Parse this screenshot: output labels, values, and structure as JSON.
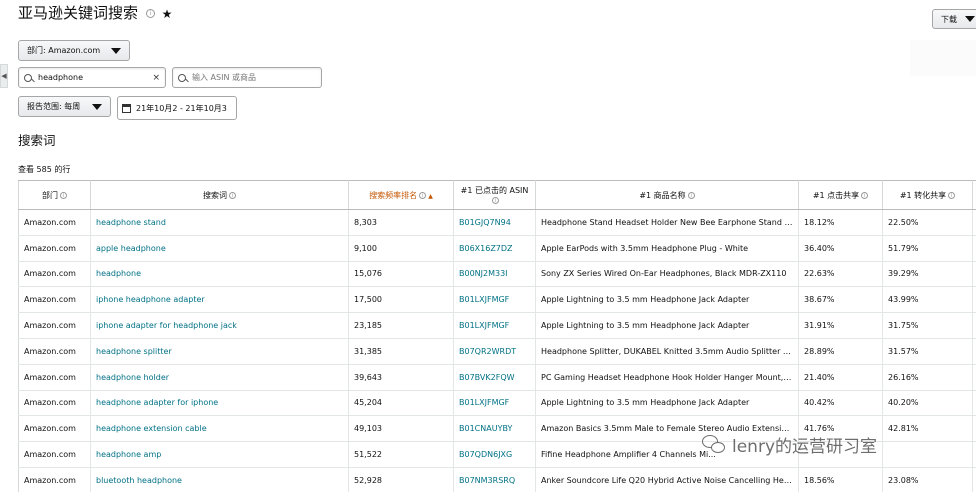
{
  "page": {
    "title": "亚马逊关键词搜索",
    "info_glyph": "i",
    "star_glyph": "★"
  },
  "toolbar": {
    "download_label": "下载",
    "department_label": "部门: Amazon.com",
    "search_value": "headphone",
    "search_clear": "×",
    "asin_placeholder": "输入 ASIN 或商品",
    "range_label": "报告范围: 每周",
    "date_value": "21年10月2 - 21年10月3"
  },
  "left_tab": {
    "glyph": "◀"
  },
  "section": {
    "title": "搜索词",
    "row_count": "查看 585 的行"
  },
  "table": {
    "headers": {
      "department": "部门",
      "search_term": "搜索词",
      "frequency_rank": "搜索频率排名",
      "clicked_asin": "#1 已点击的 ASIN",
      "product_name": "#1 商品名称",
      "click_share": "#1 点击共享",
      "conversion_share": "#1 转化共享"
    },
    "rows": [
      {
        "department": "Amazon.com",
        "term": "headphone stand",
        "rank": "8,303",
        "asin": "B01GJQ7N94",
        "product": "Headphone Stand Headset Holder New Bee Earphone Stand with...",
        "click": "18.12%",
        "conv": "22.50%"
      },
      {
        "department": "Amazon.com",
        "term": "apple headphone",
        "rank": "9,100",
        "asin": "B06X16Z7DZ",
        "product": "Apple EarPods with 3.5mm Headphone Plug - White",
        "click": "36.40%",
        "conv": "51.79%"
      },
      {
        "department": "Amazon.com",
        "term": "headphone",
        "rank": "15,076",
        "asin": "B00NJ2M33I",
        "product": "Sony ZX Series Wired On-Ear Headphones, Black MDR-ZX110",
        "click": "22.63%",
        "conv": "39.29%"
      },
      {
        "department": "Amazon.com",
        "term": "iphone headphone adapter",
        "rank": "17,500",
        "asin": "B01LXJFMGF",
        "product": "Apple Lightning to 3.5 mm Headphone Jack Adapter",
        "click": "38.67%",
        "conv": "43.99%"
      },
      {
        "department": "Amazon.com",
        "term": "iphone adapter for headphone jack",
        "rank": "23,185",
        "asin": "B01LXJFMGF",
        "product": "Apple Lightning to 3.5 mm Headphone Jack Adapter",
        "click": "31.91%",
        "conv": "31.75%"
      },
      {
        "department": "Amazon.com",
        "term": "headphone splitter",
        "rank": "31,385",
        "asin": "B07QR2WRDT",
        "product": "Headphone Splitter, DUKABEL Knitted 3.5mm Audio Splitter T...",
        "click": "28.89%",
        "conv": "31.57%"
      },
      {
        "department": "Amazon.com",
        "term": "headphone holder",
        "rank": "39,643",
        "asin": "B07BVK2FQW",
        "product": "PC Gaming Headset Headphone Hook Holder Hanger Mount, H...",
        "click": "21.40%",
        "conv": "26.16%"
      },
      {
        "department": "Amazon.com",
        "term": "headphone adapter for iphone",
        "rank": "45,204",
        "asin": "B01LXJFMGF",
        "product": "Apple Lightning to 3.5 mm Headphone Jack Adapter",
        "click": "40.42%",
        "conv": "40.20%"
      },
      {
        "department": "Amazon.com",
        "term": "headphone extension cable",
        "rank": "49,103",
        "asin": "B01CNAUYBY",
        "product": "Amazon Basics 3.5mm Male to Female Stereo Audio Extension ...",
        "click": "41.76%",
        "conv": "42.81%"
      },
      {
        "department": "Amazon.com",
        "term": "headphone amp",
        "rank": "51,522",
        "asin": "B07QDN6JXG",
        "product": "Fifine Headphone Amplifier 4 Channels Mi...",
        "click": "",
        "conv": ""
      },
      {
        "department": "Amazon.com",
        "term": "bluetooth headphone",
        "rank": "52,928",
        "asin": "B07NM3RSRQ",
        "product": "Anker Soundcore Life Q20 Hybrid Active Noise Cancelling Hea...",
        "click": "18.56%",
        "conv": "23.08%"
      }
    ]
  },
  "watermark": {
    "text": "lenry的运营研习室"
  }
}
